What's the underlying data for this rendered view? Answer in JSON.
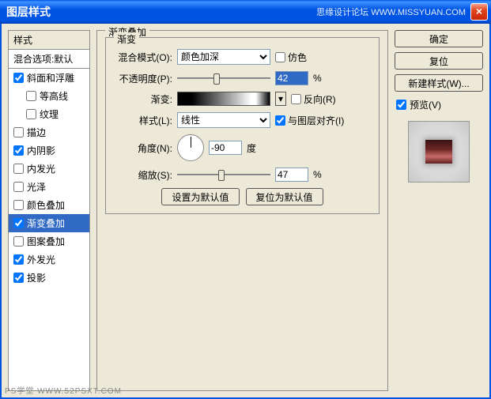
{
  "window": {
    "title": "图层样式",
    "watermark": "思缘设计论坛  WWW.MISSYUAN.COM"
  },
  "sidebar": {
    "header": "样式",
    "blend_defaults": "混合选项:默认",
    "items": [
      {
        "label": "斜面和浮雕",
        "checked": true,
        "indent": false
      },
      {
        "label": "等高线",
        "checked": false,
        "indent": true
      },
      {
        "label": "纹理",
        "checked": false,
        "indent": true
      },
      {
        "label": "描边",
        "checked": false,
        "indent": false
      },
      {
        "label": "内阴影",
        "checked": true,
        "indent": false
      },
      {
        "label": "内发光",
        "checked": false,
        "indent": false
      },
      {
        "label": "光泽",
        "checked": false,
        "indent": false
      },
      {
        "label": "颜色叠加",
        "checked": false,
        "indent": false
      },
      {
        "label": "渐变叠加",
        "checked": true,
        "indent": false,
        "selected": true
      },
      {
        "label": "图案叠加",
        "checked": false,
        "indent": false
      },
      {
        "label": "外发光",
        "checked": true,
        "indent": false
      },
      {
        "label": "投影",
        "checked": true,
        "indent": false
      }
    ]
  },
  "panel": {
    "title": "渐变叠加",
    "group_title": "渐变",
    "rows": {
      "blend_mode": {
        "label": "混合模式(O):",
        "value": "颜色加深",
        "dither_label": "仿色",
        "dither": false
      },
      "opacity": {
        "label": "不透明度(P):",
        "value": "42",
        "suffix": "%"
      },
      "gradient": {
        "label": "渐变:",
        "reverse_label": "反向(R)",
        "reverse": false
      },
      "style": {
        "label": "样式(L):",
        "value": "线性",
        "align_label": "与图层对齐(I)",
        "align": true
      },
      "angle": {
        "label": "角度(N):",
        "value": "-90",
        "suffix": "度"
      },
      "scale": {
        "label": "缩放(S):",
        "value": "47",
        "suffix": "%"
      }
    },
    "defaults": {
      "set": "设置为默认值",
      "reset": "复位为默认值"
    }
  },
  "buttons": {
    "ok": "确定",
    "cancel": "复位",
    "new_style": "新建样式(W)...",
    "preview_label": "预览(V)",
    "preview": true
  },
  "footer": "PS学堂  WWW.52PSXT.COM"
}
